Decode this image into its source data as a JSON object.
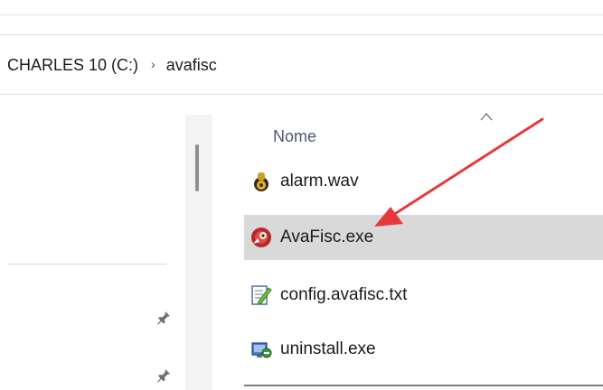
{
  "breadcrumb": {
    "drive": "CHARLES 10 (C:)",
    "separator": "›",
    "folder": "avafisc"
  },
  "filelist": {
    "sort_indicator": "chevron-up-icon",
    "column_header": "Nome",
    "files": [
      {
        "name": "alarm.wav",
        "icon": "audio-file-icon",
        "selected": false
      },
      {
        "name": "AvaFisc.exe",
        "icon": "avafisc-app-icon",
        "selected": true
      },
      {
        "name": "config.avafisc.txt",
        "icon": "text-file-icon",
        "selected": false
      },
      {
        "name": "uninstall.exe",
        "icon": "uninstaller-icon",
        "selected": false
      }
    ]
  },
  "navpane": {
    "pin_icon": "pin-icon"
  },
  "annotation": {
    "arrow_color": "#e8373a"
  },
  "colors": {
    "selection": "#d9d9d9",
    "header_text": "#4a5a6e"
  }
}
